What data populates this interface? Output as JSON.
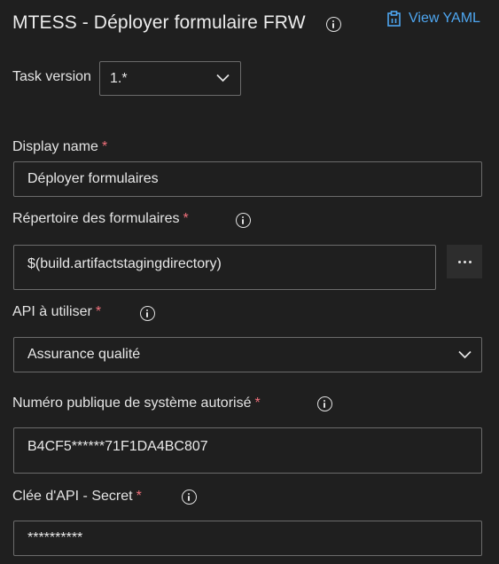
{
  "header": {
    "title": "MTESS - Déployer formulaire FRW",
    "view_yaml_label": "View YAML"
  },
  "task_version": {
    "label": "Task version",
    "value": "1.*"
  },
  "display_name": {
    "label": "Display name",
    "required": "*",
    "value": "Déployer formulaires"
  },
  "forms_dir": {
    "label": "Répertoire des formulaires",
    "required": "*",
    "value": "$(build.artifactstagingdirectory)",
    "more_label": "..."
  },
  "api": {
    "label": "API à utiliser",
    "required": "*",
    "value": "Assurance qualité"
  },
  "system_number": {
    "label": "Numéro publique de système autorisé",
    "required": "*",
    "value": "B4CF5******71F1DA4BC807"
  },
  "api_secret": {
    "label": "Clée d'API - Secret",
    "required": "*",
    "value": "**********"
  },
  "colors": {
    "background": "#1f1f1f",
    "accent": "#4ea6f0",
    "required": "#f1707b",
    "border": "#6b6b6b"
  },
  "icons": [
    "info-icon",
    "clipboard-icon",
    "chevron-down-icon",
    "more-icon"
  ]
}
